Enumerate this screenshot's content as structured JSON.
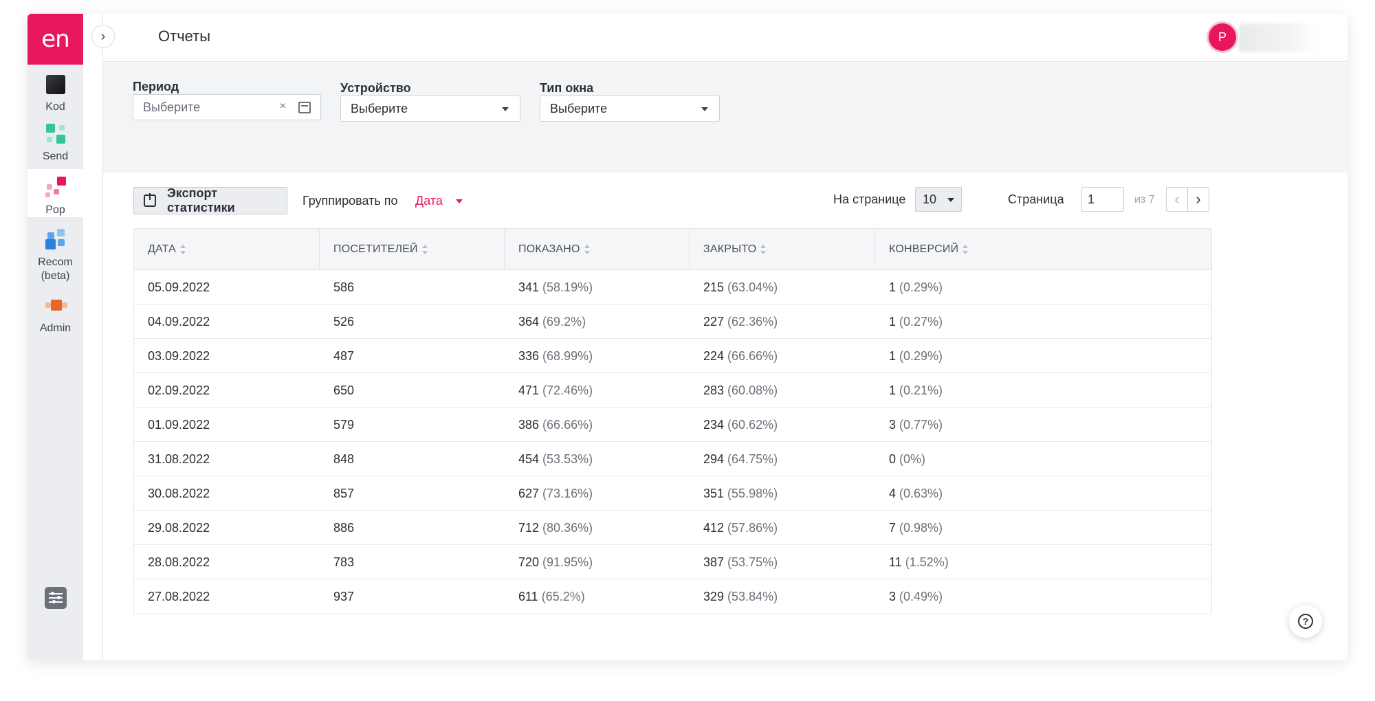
{
  "app": {
    "logo": "en",
    "title": "Отчеты",
    "avatar_initial": "P"
  },
  "sidebar": {
    "items": [
      {
        "label": "Kod",
        "icon": "kod-icon"
      },
      {
        "label": "Send",
        "icon": "send-icon"
      },
      {
        "label": "Pop",
        "icon": "pop-icon"
      },
      {
        "label": "Recom (beta)",
        "icon": "recom-icon"
      },
      {
        "label": "Admin",
        "icon": "admin-icon"
      }
    ],
    "settings_icon": "settings-sliders-icon"
  },
  "filters": {
    "period": {
      "label": "Период",
      "placeholder": "Выберите",
      "clear": "×"
    },
    "device": {
      "label": "Устройство",
      "value": "Выберите"
    },
    "window_type": {
      "label": "Тип окна",
      "value": "Выберите"
    }
  },
  "toolbar": {
    "export_label": "Экспорт статистики",
    "group_label": "Группировать по",
    "group_value": "Дата",
    "per_page_label": "На странице",
    "per_page_value": "10",
    "page_label": "Страница",
    "page_value": "1",
    "page_of": "из 7"
  },
  "table": {
    "columns": [
      "ДАТА",
      "ПОСЕТИТЕЛЕЙ",
      "ПОКАЗАНО",
      "ЗАКРЫТО",
      "КОНВЕРСИЙ"
    ],
    "rows": [
      {
        "date": "05.09.2022",
        "visitors": "586",
        "shown": "341",
        "shown_pct": "(58.19%)",
        "closed": "215",
        "closed_pct": "(63.04%)",
        "conv": "1",
        "conv_pct": "(0.29%)"
      },
      {
        "date": "04.09.2022",
        "visitors": "526",
        "shown": "364",
        "shown_pct": "(69.2%)",
        "closed": "227",
        "closed_pct": "(62.36%)",
        "conv": "1",
        "conv_pct": "(0.27%)"
      },
      {
        "date": "03.09.2022",
        "visitors": "487",
        "shown": "336",
        "shown_pct": "(68.99%)",
        "closed": "224",
        "closed_pct": "(66.66%)",
        "conv": "1",
        "conv_pct": "(0.29%)"
      },
      {
        "date": "02.09.2022",
        "visitors": "650",
        "shown": "471",
        "shown_pct": "(72.46%)",
        "closed": "283",
        "closed_pct": "(60.08%)",
        "conv": "1",
        "conv_pct": "(0.21%)"
      },
      {
        "date": "01.09.2022",
        "visitors": "579",
        "shown": "386",
        "shown_pct": "(66.66%)",
        "closed": "234",
        "closed_pct": "(60.62%)",
        "conv": "3",
        "conv_pct": "(0.77%)"
      },
      {
        "date": "31.08.2022",
        "visitors": "848",
        "shown": "454",
        "shown_pct": "(53.53%)",
        "closed": "294",
        "closed_pct": "(64.75%)",
        "conv": "0",
        "conv_pct": "(0%)"
      },
      {
        "date": "30.08.2022",
        "visitors": "857",
        "shown": "627",
        "shown_pct": "(73.16%)",
        "closed": "351",
        "closed_pct": "(55.98%)",
        "conv": "4",
        "conv_pct": "(0.63%)"
      },
      {
        "date": "29.08.2022",
        "visitors": "886",
        "shown": "712",
        "shown_pct": "(80.36%)",
        "closed": "412",
        "closed_pct": "(57.86%)",
        "conv": "7",
        "conv_pct": "(0.98%)"
      },
      {
        "date": "28.08.2022",
        "visitors": "783",
        "shown": "720",
        "shown_pct": "(91.95%)",
        "closed": "387",
        "closed_pct": "(53.75%)",
        "conv": "11",
        "conv_pct": "(1.52%)"
      },
      {
        "date": "27.08.2022",
        "visitors": "937",
        "shown": "611",
        "shown_pct": "(65.2%)",
        "closed": "329",
        "closed_pct": "(53.84%)",
        "conv": "3",
        "conv_pct": "(0.49%)"
      }
    ]
  },
  "colors": {
    "brand": "#e8175d",
    "sidebar_bg": "#ebedf1",
    "filters_bg": "#f3f4f6"
  },
  "help_icon": "help-icon"
}
